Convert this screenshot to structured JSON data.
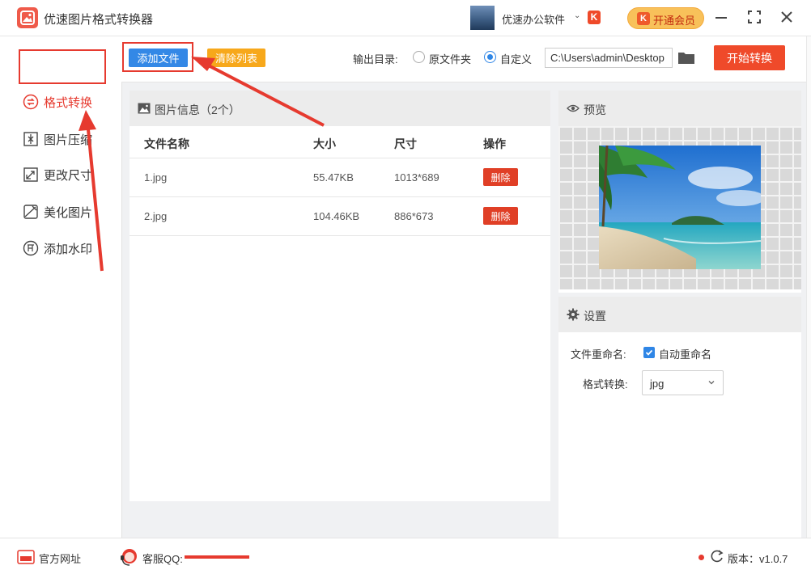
{
  "window": {
    "title": "优速图片格式转换器",
    "brand_name": "优速办公软件",
    "brand_caret": "⌄",
    "brand_badge": "K",
    "vip_badge": "K",
    "vip_label": "开通会员"
  },
  "sidebar": {
    "items": [
      {
        "label": "格式转换",
        "icon": "format-convert-icon",
        "active": true
      },
      {
        "label": "图片压缩",
        "icon": "compress-icon",
        "active": false
      },
      {
        "label": "更改尺寸",
        "icon": "resize-icon",
        "active": false
      },
      {
        "label": "美化图片",
        "icon": "beautify-icon",
        "active": false
      },
      {
        "label": "添加水印",
        "icon": "watermark-icon",
        "active": false
      }
    ]
  },
  "toolbar": {
    "add_files": "添加文件",
    "clear_list": "清除列表",
    "output_label": "输出目录:",
    "option_original": "原文件夹",
    "option_custom": "自定义",
    "selected_option": "自定义",
    "output_path": "C:\\Users\\admin\\Desktop",
    "start": "开始转换"
  },
  "file_list": {
    "title": "图片信息（2个）",
    "columns": [
      "文件名称",
      "大小",
      "尺寸",
      "操作"
    ],
    "rows": [
      {
        "name": "1.jpg",
        "size": "55.47KB",
        "dims": "1013*689",
        "action": "删除"
      },
      {
        "name": "2.jpg",
        "size": "104.46KB",
        "dims": "886*673",
        "action": "删除"
      }
    ]
  },
  "preview": {
    "title": "预览"
  },
  "settings": {
    "title": "设置",
    "rename_label": "文件重命名:",
    "rename_option": "自动重命名",
    "rename_checked": true,
    "format_label": "格式转换:",
    "format_value": "jpg"
  },
  "status": {
    "site": "官方网址",
    "qq_label": "客服QQ:",
    "version_label": "版本：v1.0.7"
  },
  "colors": {
    "accent_red": "#e63a2f",
    "primary_blue": "#3388e6",
    "orange": "#f7a81b",
    "start_red": "#ef4a2a"
  }
}
